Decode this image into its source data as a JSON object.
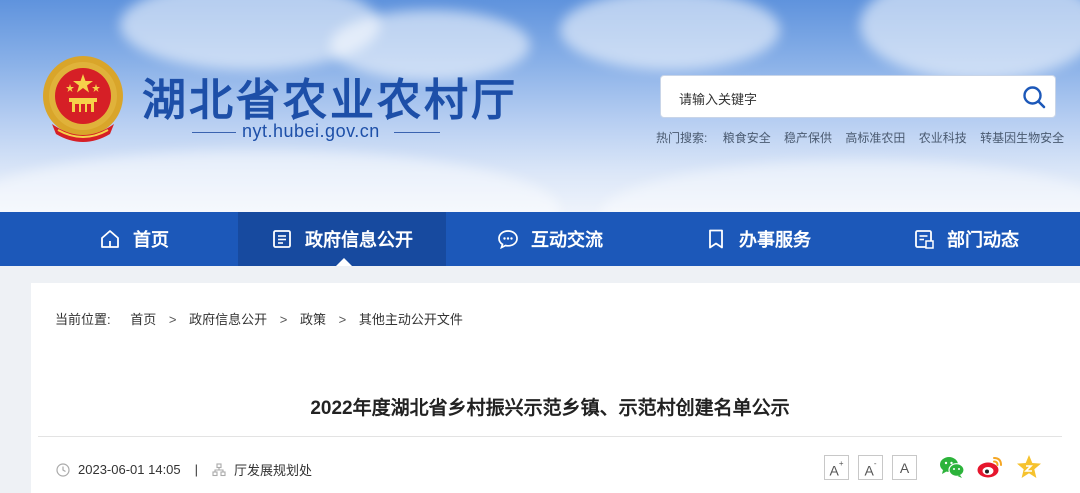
{
  "header": {
    "site_name": "湖北省农业农村厅",
    "domain": "nyt.hubei.gov.cn"
  },
  "search": {
    "placeholder": "请输入关键字",
    "hot_label": "热门搜索:",
    "hot_terms": [
      "粮食安全",
      "稳产保供",
      "高标准农田",
      "农业科技",
      "转基因生物安全"
    ]
  },
  "nav": {
    "items": [
      {
        "label": "首页",
        "icon": "home-icon"
      },
      {
        "label": "政府信息公开",
        "icon": "document-list-icon"
      },
      {
        "label": "互动交流",
        "icon": "chat-icon"
      },
      {
        "label": "办事服务",
        "icon": "bookmark-icon"
      },
      {
        "label": "部门动态",
        "icon": "news-icon"
      }
    ],
    "active": "政府信息公开"
  },
  "breadcrumb": {
    "label": "当前位置:",
    "items": [
      "首页",
      "政府信息公开",
      "政策",
      "其他主动公开文件"
    ],
    "separator": ">"
  },
  "article": {
    "title": "2022年度湖北省乡村振兴示范乡镇、示范村创建名单公示",
    "date": "2023-06-01 14:05",
    "divider": "|",
    "source": "厅发展规划处"
  },
  "tools": {
    "font_increase": "A",
    "font_increase_mark": "+",
    "font_decrease": "A",
    "font_decrease_mark": "-",
    "font_reset": "A"
  },
  "share": [
    "wechat-icon",
    "weibo-icon",
    "favorite-star-icon"
  ],
  "colors": {
    "brand_blue": "#1c58b9",
    "nav_active": "#174a9f",
    "title_text": "#1d4fa8"
  }
}
